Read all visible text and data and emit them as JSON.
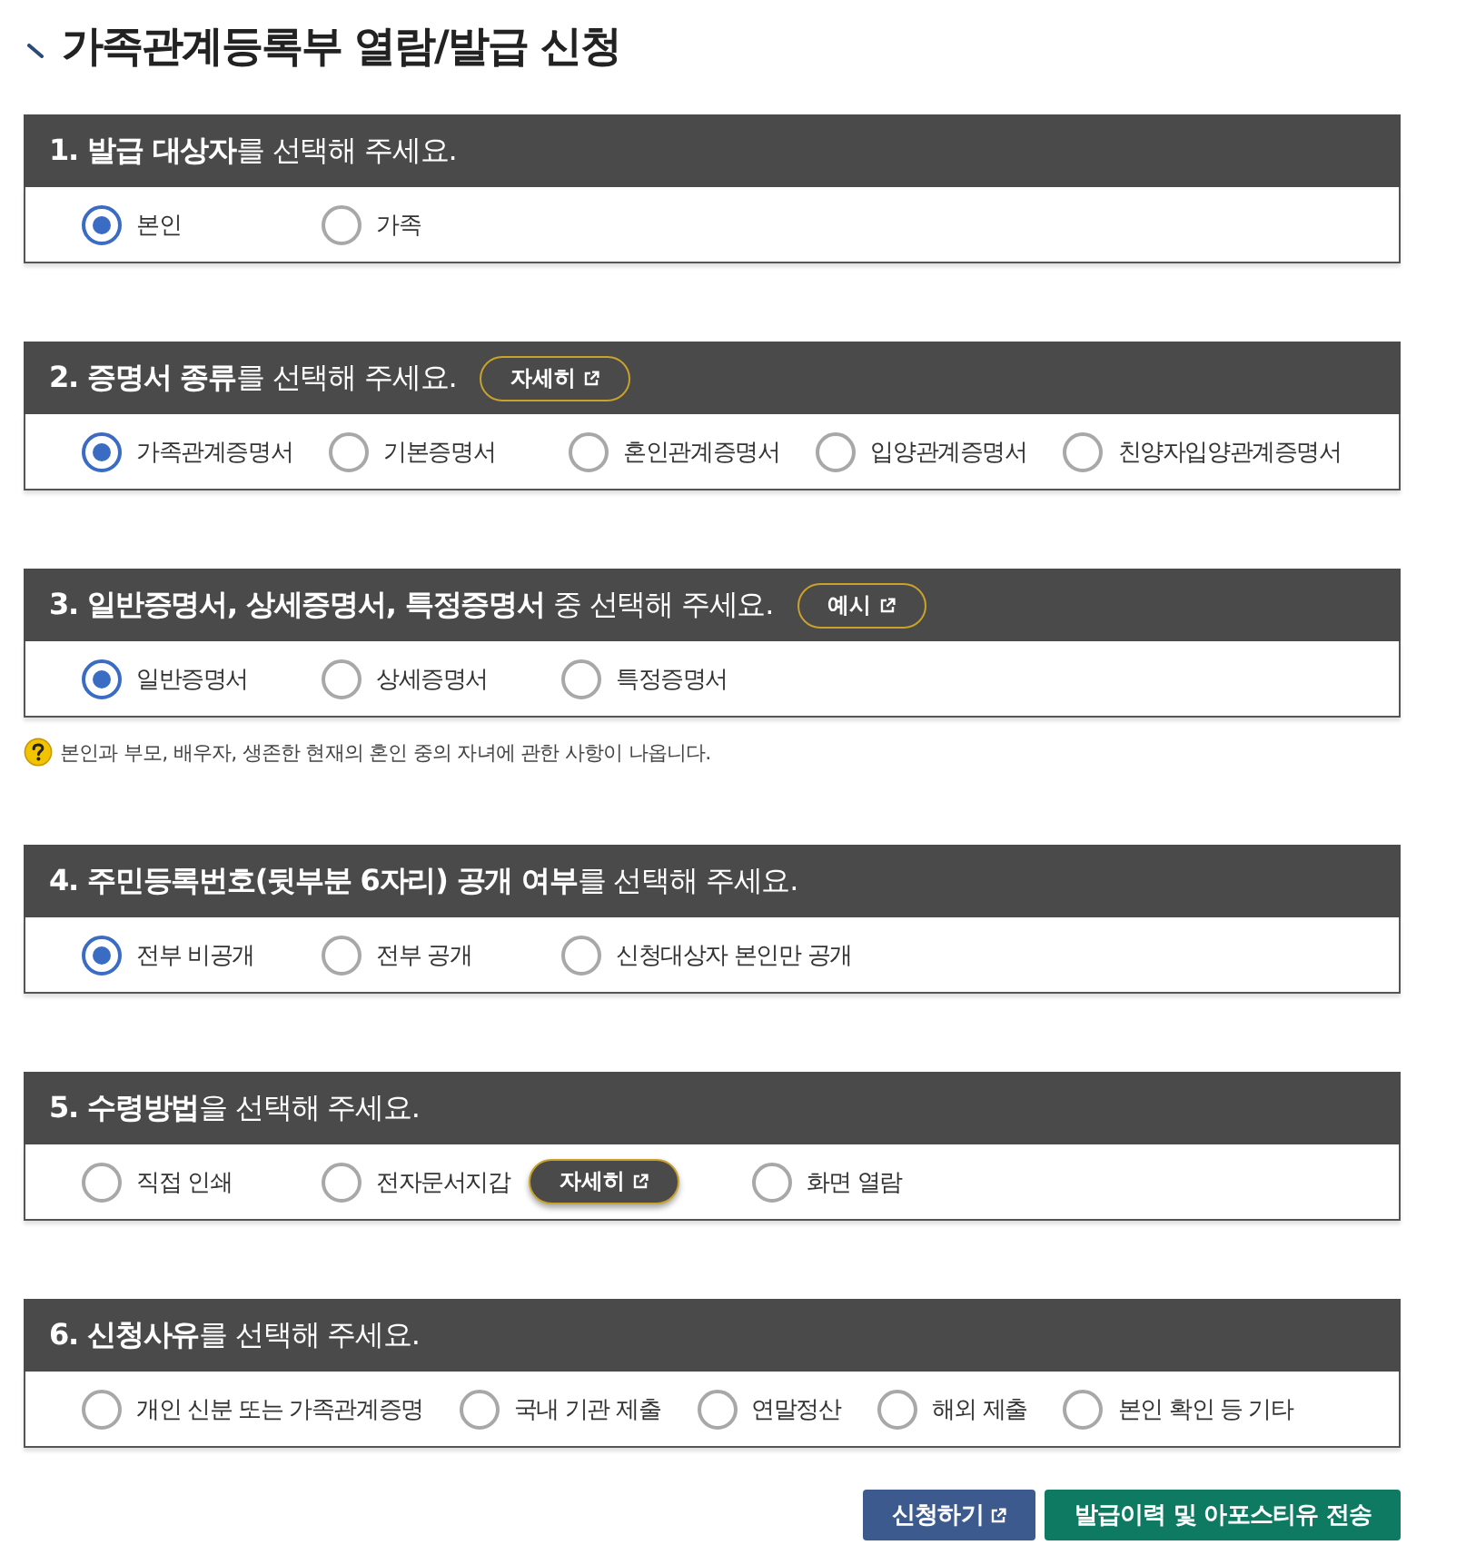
{
  "title": "가족관계등록부 열람/발급 신청",
  "sections": [
    {
      "heading": "**1. 발급 대상자**를 선택해 주세요.",
      "options": [
        {
          "label": "본인",
          "selected": true
        },
        {
          "label": "가족",
          "selected": false
        }
      ]
    },
    {
      "heading": "**2. 증명서 종류**를 선택해 주세요.",
      "heading_button": {
        "label": "자세히",
        "external": true
      },
      "options": [
        {
          "label": "가족관계증명서",
          "selected": true
        },
        {
          "label": "기본증명서",
          "selected": false
        },
        {
          "label": "혼인관계증명서",
          "selected": false
        },
        {
          "label": "입양관계증명서",
          "selected": false
        },
        {
          "label": "친양자입양관계증명서",
          "selected": false
        }
      ]
    },
    {
      "heading": "**3. 일반증명서, 상세증명서, 특정증명서** 중 선택해 주세요.",
      "heading_button": {
        "label": "예시",
        "external": true
      },
      "options": [
        {
          "label": "일반증명서",
          "selected": true
        },
        {
          "label": "상세증명서",
          "selected": false
        },
        {
          "label": "특정증명서",
          "selected": false
        }
      ],
      "note": "본인과 부모, 배우자, 생존한 현재의 혼인 중의 자녀에 관한 사항이 나옵니다."
    },
    {
      "heading": "**4. 주민등록번호(뒷부분 6자리) 공개 여부**를 선택해 주세요.",
      "options": [
        {
          "label": "전부 비공개",
          "selected": true
        },
        {
          "label": "전부 공개",
          "selected": false
        },
        {
          "label": "신청대상자 본인만 공개",
          "selected": false
        }
      ]
    },
    {
      "heading": "**5. 수령방법**을 선택해 주세요.",
      "options": [
        {
          "label": "직접 인쇄",
          "selected": false
        },
        {
          "label": "전자문서지갑",
          "selected": false,
          "button": {
            "label": "자세히",
            "external": true
          }
        },
        {
          "label": "화면 열람",
          "selected": false
        }
      ]
    },
    {
      "heading": "**6. 신청사유**를 선택해 주세요.",
      "options": [
        {
          "label": "개인 신분 또는 가족관계증명",
          "selected": false
        },
        {
          "label": "국내 기관 제출",
          "selected": false
        },
        {
          "label": "연말정산",
          "selected": false
        },
        {
          "label": "해외 제출",
          "selected": false
        },
        {
          "label": "본인 확인 등 기타",
          "selected": false
        }
      ]
    }
  ],
  "buttons": [
    {
      "label": "신청하기",
      "kind": "primary",
      "external": true
    },
    {
      "label": "발급이력 및 아포스티유 전송",
      "kind": "secondary",
      "external": false
    }
  ]
}
